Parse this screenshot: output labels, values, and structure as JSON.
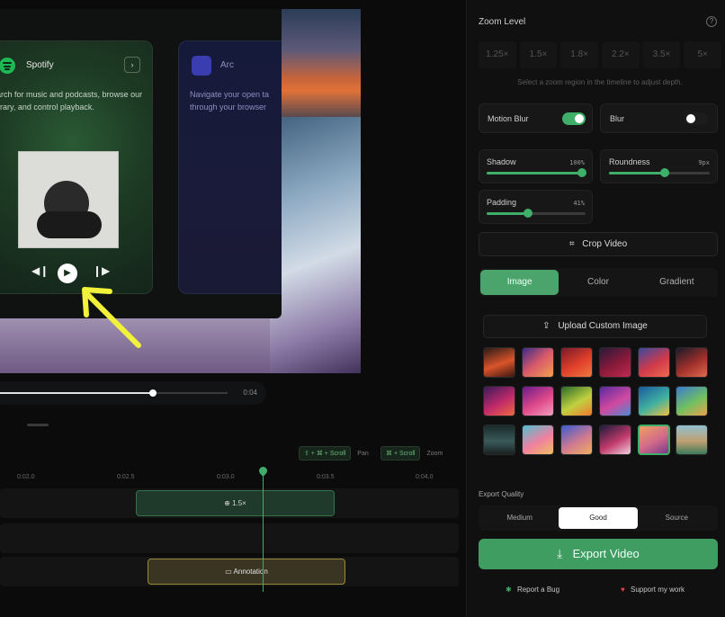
{
  "timeline": {
    "time_label": "0:04",
    "ticks": [
      "0:02.0",
      "0:02.5",
      "0:03.0",
      "0:03.5",
      "0:04.0"
    ],
    "hint_pan_keys": "⇧ + ⌘ + Scroll",
    "hint_pan": "Pan",
    "hint_zoom_keys": "⌘ + Scroll",
    "hint_zoom": "Zoom",
    "zoom_clip_label": "1.5×",
    "annotation_clip_label": "Annotation"
  },
  "preview": {
    "spotify_title": "Spotify",
    "spotify_desc": "earch for music and podcasts, browse our library, and control playback.",
    "arc_title": "Arc",
    "arc_desc": "Navigate your open ta through your browser"
  },
  "panel": {
    "zoom_title": "Zoom Level",
    "zoom_options": [
      "1.25×",
      "1.5×",
      "1.8×",
      "2.2×",
      "3.5×",
      "5×"
    ],
    "zoom_hint": "Select a zoom region in the timeline to adjust depth.",
    "motion_blur": "Motion Blur",
    "blur": "Blur",
    "shadow": {
      "label": "Shadow",
      "value": "100%"
    },
    "roundness": {
      "label": "Roundness",
      "value": "9px"
    },
    "padding": {
      "label": "Padding",
      "value": "41%"
    },
    "crop": "Crop Video",
    "bg_tabs": [
      "Image",
      "Color",
      "Gradient"
    ],
    "upload": "Upload Custom Image",
    "export_quality": "Export Quality",
    "quality_options": [
      "Medium",
      "Good",
      "Source"
    ],
    "export": "Export Video",
    "report": "Report a Bug",
    "support": "Support my work"
  }
}
